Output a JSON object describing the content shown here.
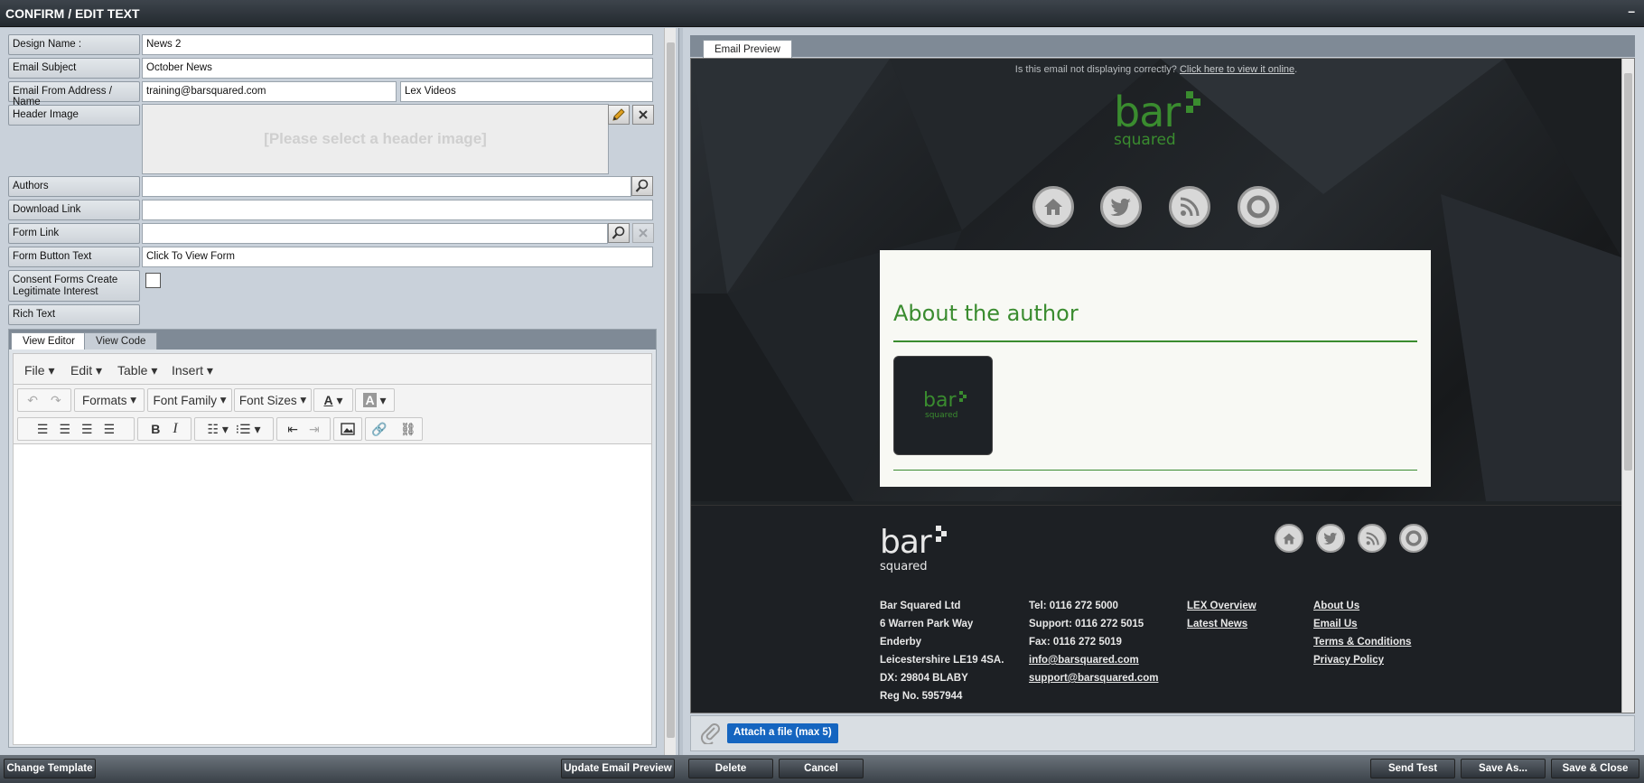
{
  "window": {
    "title": "CONFIRM / EDIT TEXT",
    "minimize": "–"
  },
  "form": {
    "design_name_label": "Design Name :",
    "design_name_value": "News 2",
    "subject_label": "Email Subject",
    "subject_value": "October News",
    "from_label": "Email From Address / Name",
    "from_address": "training@barsquared.com",
    "from_name": "Lex Videos",
    "header_image_label": "Header Image",
    "header_image_placeholder": "[Please select a header image]",
    "authors_label": "Authors",
    "authors_value": "",
    "download_label": "Download Link",
    "download_value": "",
    "form_link_label": "Form Link",
    "form_link_value": "",
    "form_button_label": "Form Button Text",
    "form_button_value": "Click To View Form",
    "consent_label": "Consent Forms Create Legitimate Interest",
    "consent_checked": false,
    "rich_text_label": "Rich Text"
  },
  "editor": {
    "tabs": [
      "View Editor",
      "View Code"
    ],
    "menu": [
      "File",
      "Edit",
      "Table",
      "Insert"
    ],
    "toolbar": {
      "formats": "Formats",
      "font_family": "Font Family",
      "font_sizes": "Font Sizes",
      "font_color": "A",
      "bg_color": "A",
      "bold": "B",
      "italic": "I"
    }
  },
  "left_buttons": {
    "change_template": "Change Template",
    "update_preview": "Update Email Preview"
  },
  "preview": {
    "tab": "Email Preview",
    "notice_text": "Is this email not displaying correctly?",
    "notice_link": "Click here to view it online",
    "notice_end": ".",
    "logo_main": "bar",
    "logo_sub": "squared",
    "card_title": "About the author",
    "footer": {
      "address": [
        "Bar Squared Ltd",
        "6 Warren Park Way",
        "Enderby",
        "Leicestershire LE19 4SA.",
        "DX: 29804 BLABY",
        "Reg No. 5957944"
      ],
      "contact_text": [
        "Tel: 0116 272 5000",
        "Support: 0116 272 5015",
        "Fax: 0116 272 5019"
      ],
      "contact_links": [
        "info@barsquared.com",
        "support@barsquared.com"
      ],
      "links_1": [
        "LEX Overview",
        "Latest News"
      ],
      "links_2": [
        "About Us",
        "Email Us",
        "Terms & Conditions",
        "Privacy Policy"
      ]
    }
  },
  "attach": {
    "label": "Attach a file (max 5)"
  },
  "right_buttons": {
    "delete": "Delete",
    "cancel": "Cancel",
    "send_test": "Send Test",
    "save_as": "Save As...",
    "save_close": "Save & Close"
  },
  "colors": {
    "brand_green": "#3a8c2f",
    "attach_blue": "#1565c0",
    "preview_bg": "#1f2326"
  },
  "icons": [
    "edit-pencil-icon",
    "clear-x-icon",
    "search-icon",
    "home-icon",
    "twitter-icon",
    "rss-icon",
    "support-ring-icon",
    "paperclip-icon"
  ]
}
